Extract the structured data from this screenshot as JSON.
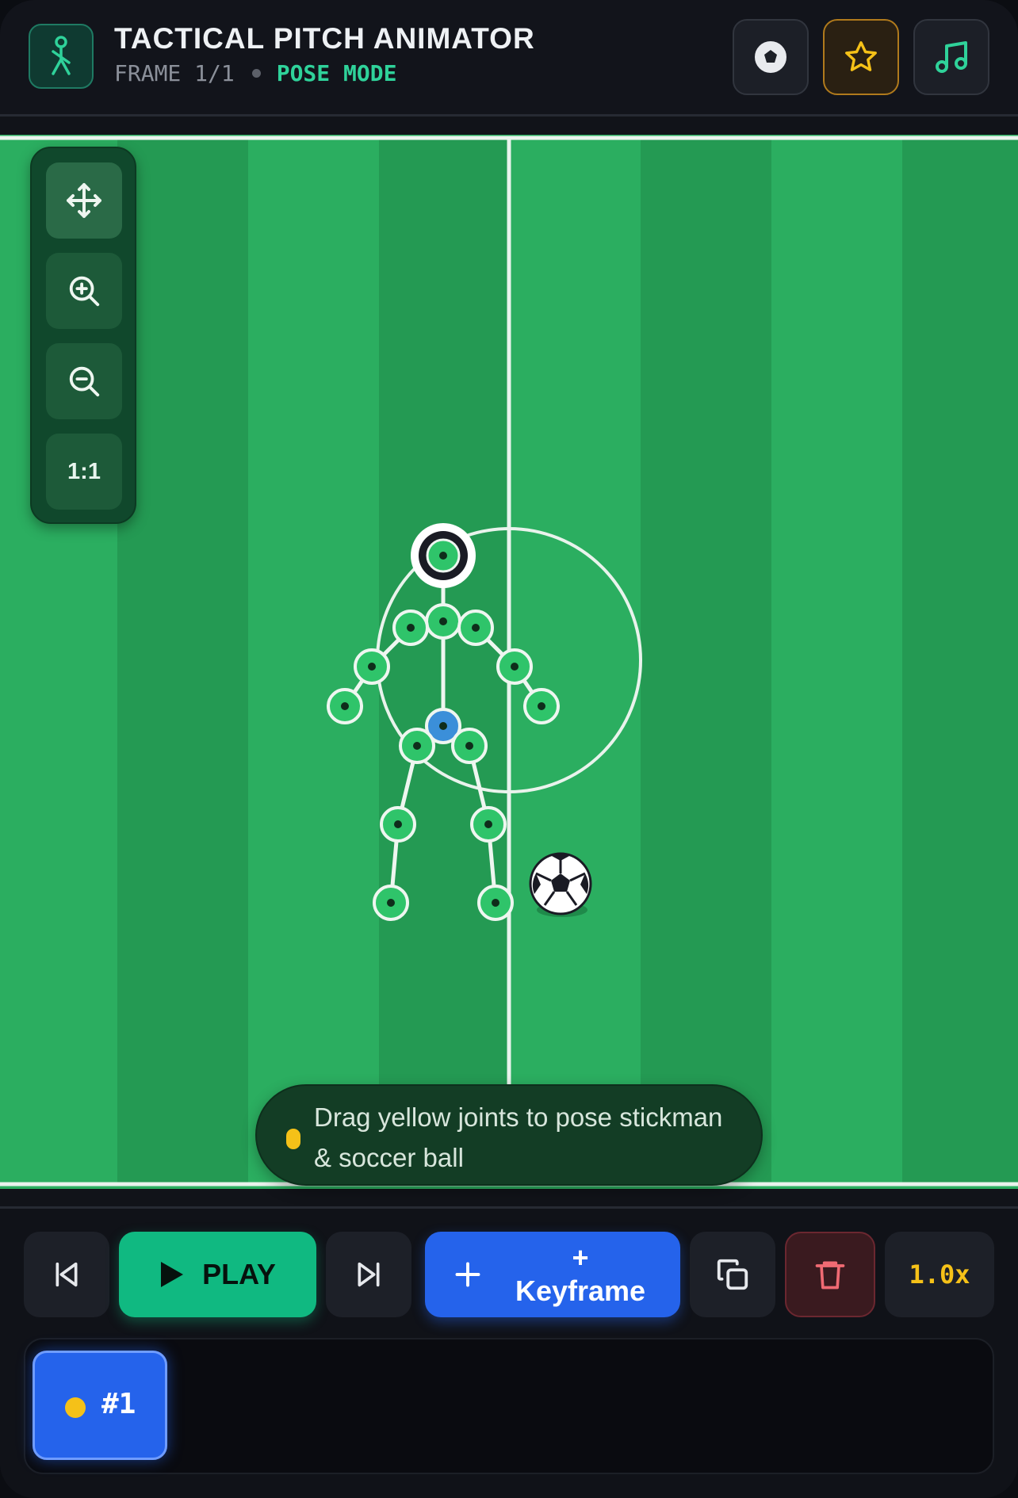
{
  "header": {
    "title": "TACTICAL PITCH ANIMATOR",
    "frame_label": "FRAME 1/1",
    "mode_label": "POSE MODE"
  },
  "zoom": {
    "reset_label": "1:1"
  },
  "hint": {
    "text": "Drag yellow joints to pose stickman & soccer ball"
  },
  "controls": {
    "play_label": "PLAY",
    "keyframe_label": "+\nKeyframe",
    "speed_label": "1.0x"
  },
  "timeline": {
    "frames": [
      {
        "label": "#1"
      }
    ]
  },
  "colors": {
    "pitch_light": "#2bae60",
    "pitch_dark": "#249a53",
    "accent_green": "#10b981",
    "accent_blue": "#2563eb",
    "joint_yellow": "#f5c118",
    "hip_joint_blue": "#3b8fd9"
  }
}
